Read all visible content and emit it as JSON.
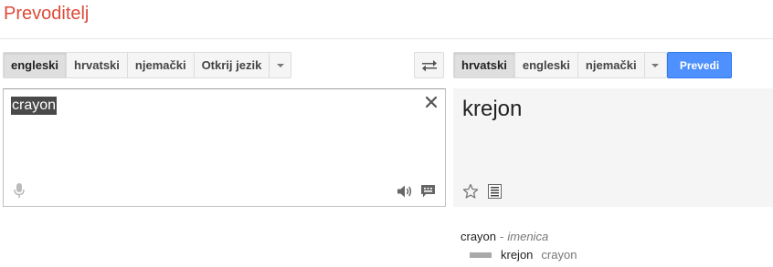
{
  "app": {
    "title": "Prevoditelj"
  },
  "colors": {
    "brand": "#dd4b39",
    "accent": "#4d90fe",
    "result_background": "#f5f5f5"
  },
  "source_languages": {
    "items": [
      "engleski",
      "hrvatski",
      "njemački",
      "Otkrij jezik"
    ],
    "selected": "engleski",
    "more_icon": "chevron-down-icon"
  },
  "swap": {
    "icon": "swap-arrows-icon"
  },
  "target_languages": {
    "items": [
      "hrvatski",
      "engleski",
      "njemački"
    ],
    "selected": "hrvatski",
    "more_icon": "chevron-down-icon"
  },
  "translate_button": {
    "label": "Prevedi"
  },
  "source": {
    "text": "crayon",
    "icons": [
      "clear-icon",
      "microphone-icon",
      "speaker-icon",
      "keyboard-icon"
    ]
  },
  "result": {
    "text": "krejon",
    "icons": [
      "star-icon",
      "list-icon"
    ]
  },
  "dictionary": {
    "word": "crayon",
    "separator": "-",
    "part_of_speech": "imenica",
    "entries": [
      {
        "translation": "krejon",
        "back_translation": "crayon",
        "frequency": 0.33
      }
    ]
  }
}
